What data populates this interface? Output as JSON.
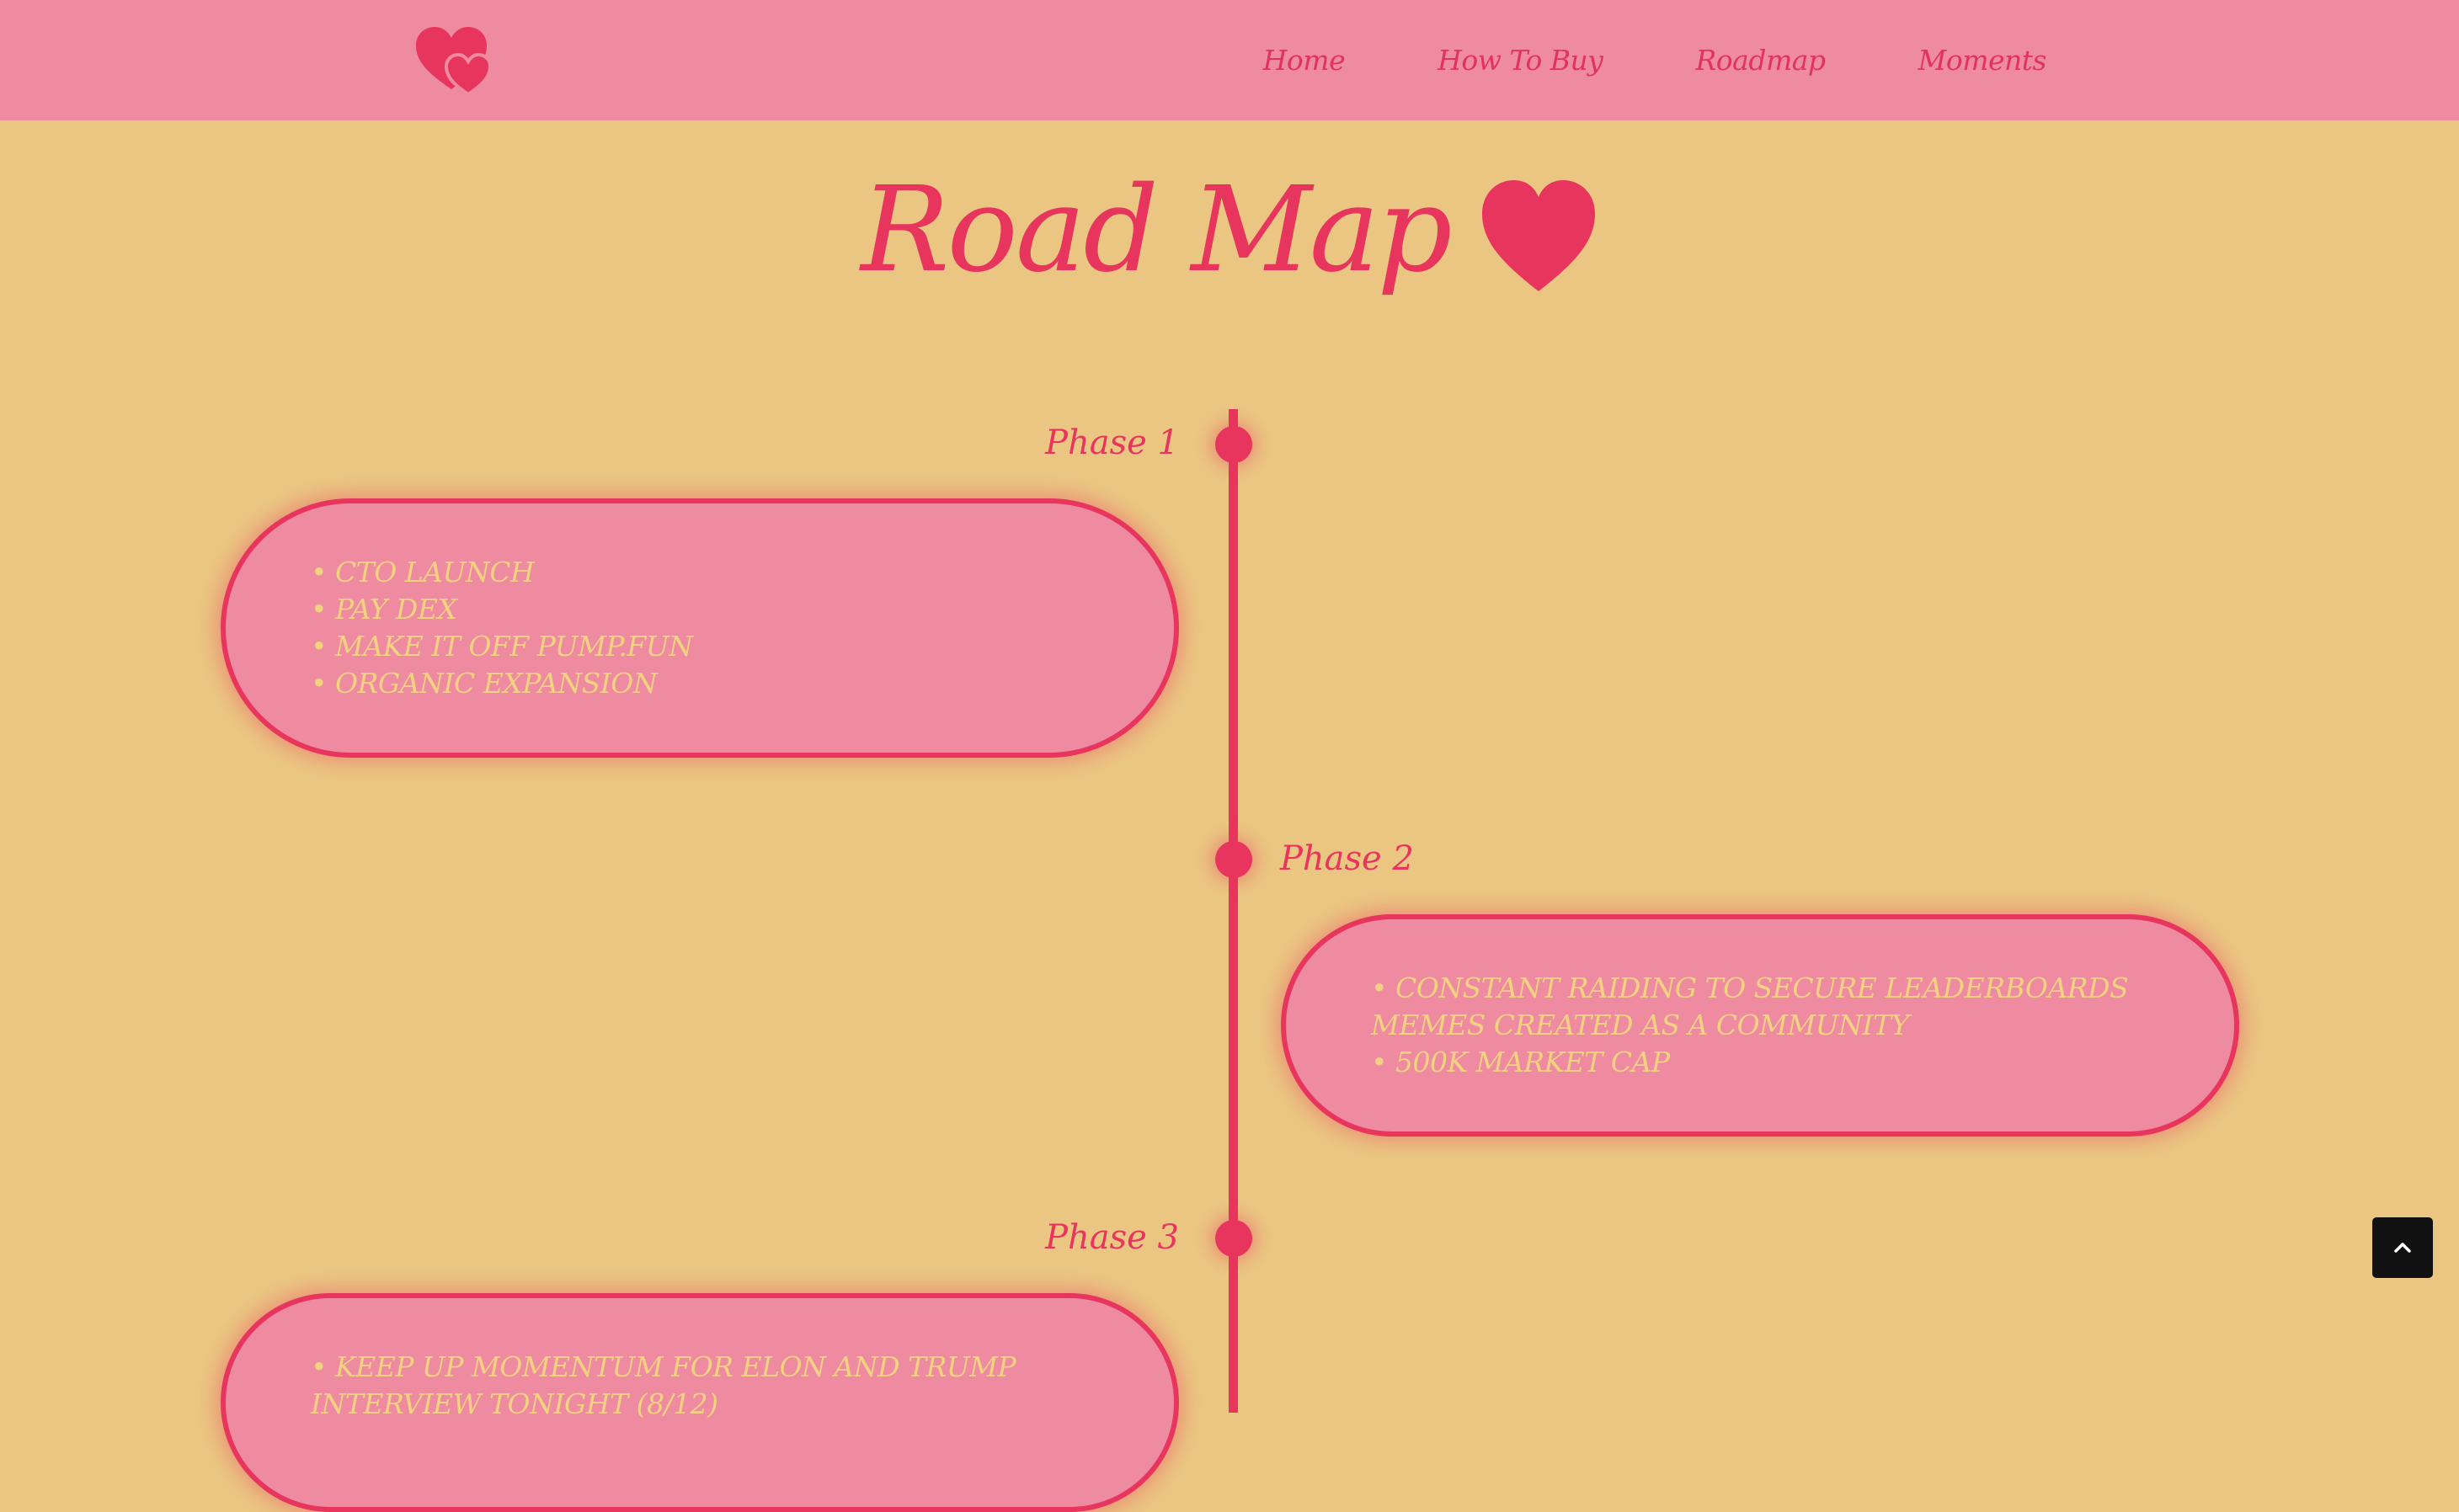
{
  "nav": {
    "logo_icon": "double-heart-icon",
    "links": [
      "Home",
      "How To Buy",
      "Roadmap",
      "Moments"
    ]
  },
  "heading": {
    "title": "Road Map",
    "icon": "heart-icon"
  },
  "phases": [
    {
      "label": "Phase 1",
      "items": [
        "• CTO LAUNCH",
        "• PAY DEX",
        "• MAKE IT OFF PUMP.FUN",
        "• ORGANIC EXPANSION"
      ]
    },
    {
      "label": "Phase 2",
      "items": [
        "• CONSTANT RAIDING TO SECURE LEADERBOARDS",
        "MEMES CREATED AS A COMMUNITY",
        "• 500K MARKET CAP"
      ]
    },
    {
      "label": "Phase 3",
      "items": [
        "• KEEP UP MOMENTUM FOR ELON AND TRUMP",
        "INTERVIEW TONIGHT (8/12)"
      ]
    }
  ],
  "scroll_top": {
    "icon": "chevron-up-icon"
  },
  "colors": {
    "background": "#EBC682",
    "nav_background": "#EE8BA1",
    "accent": "#E8355E",
    "card_text": "#F2D281"
  }
}
